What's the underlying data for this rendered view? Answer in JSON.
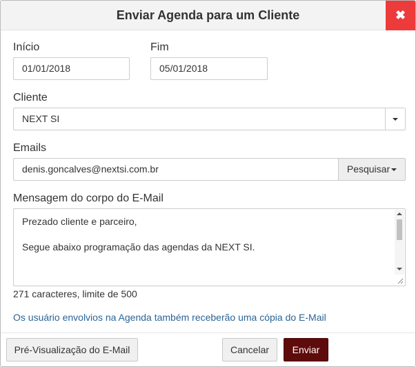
{
  "dialog": {
    "title": "Enviar Agenda para um Cliente",
    "close_icon": "close-icon"
  },
  "form": {
    "start": {
      "label": "Início",
      "value": "01/01/2018"
    },
    "end": {
      "label": "Fim",
      "value": "05/01/2018"
    },
    "client": {
      "label": "Cliente",
      "selected": "NEXT SI"
    },
    "emails": {
      "label": "Emails",
      "value": "denis.goncalves@nextsi.com.br",
      "search_label": "Pesquisar"
    },
    "message": {
      "label": "Mensagem do corpo do E-Mail",
      "lines": [
        "Prezado cliente e parceiro,",
        "",
        "Segue abaixo programação das agendas da NEXT SI."
      ],
      "counter": "271 caracteres, limite de 500"
    },
    "info": "Os usuário envolvios na Agenda também receberão uma cópia do E-Mail"
  },
  "footer": {
    "preview_label": "Pré-Visualização do E-Mail",
    "cancel_label": "Cancelar",
    "send_label": "Enviar"
  },
  "colors": {
    "close": "#ed3b3b",
    "send": "#5e0b0b",
    "link": "#2a6496"
  }
}
